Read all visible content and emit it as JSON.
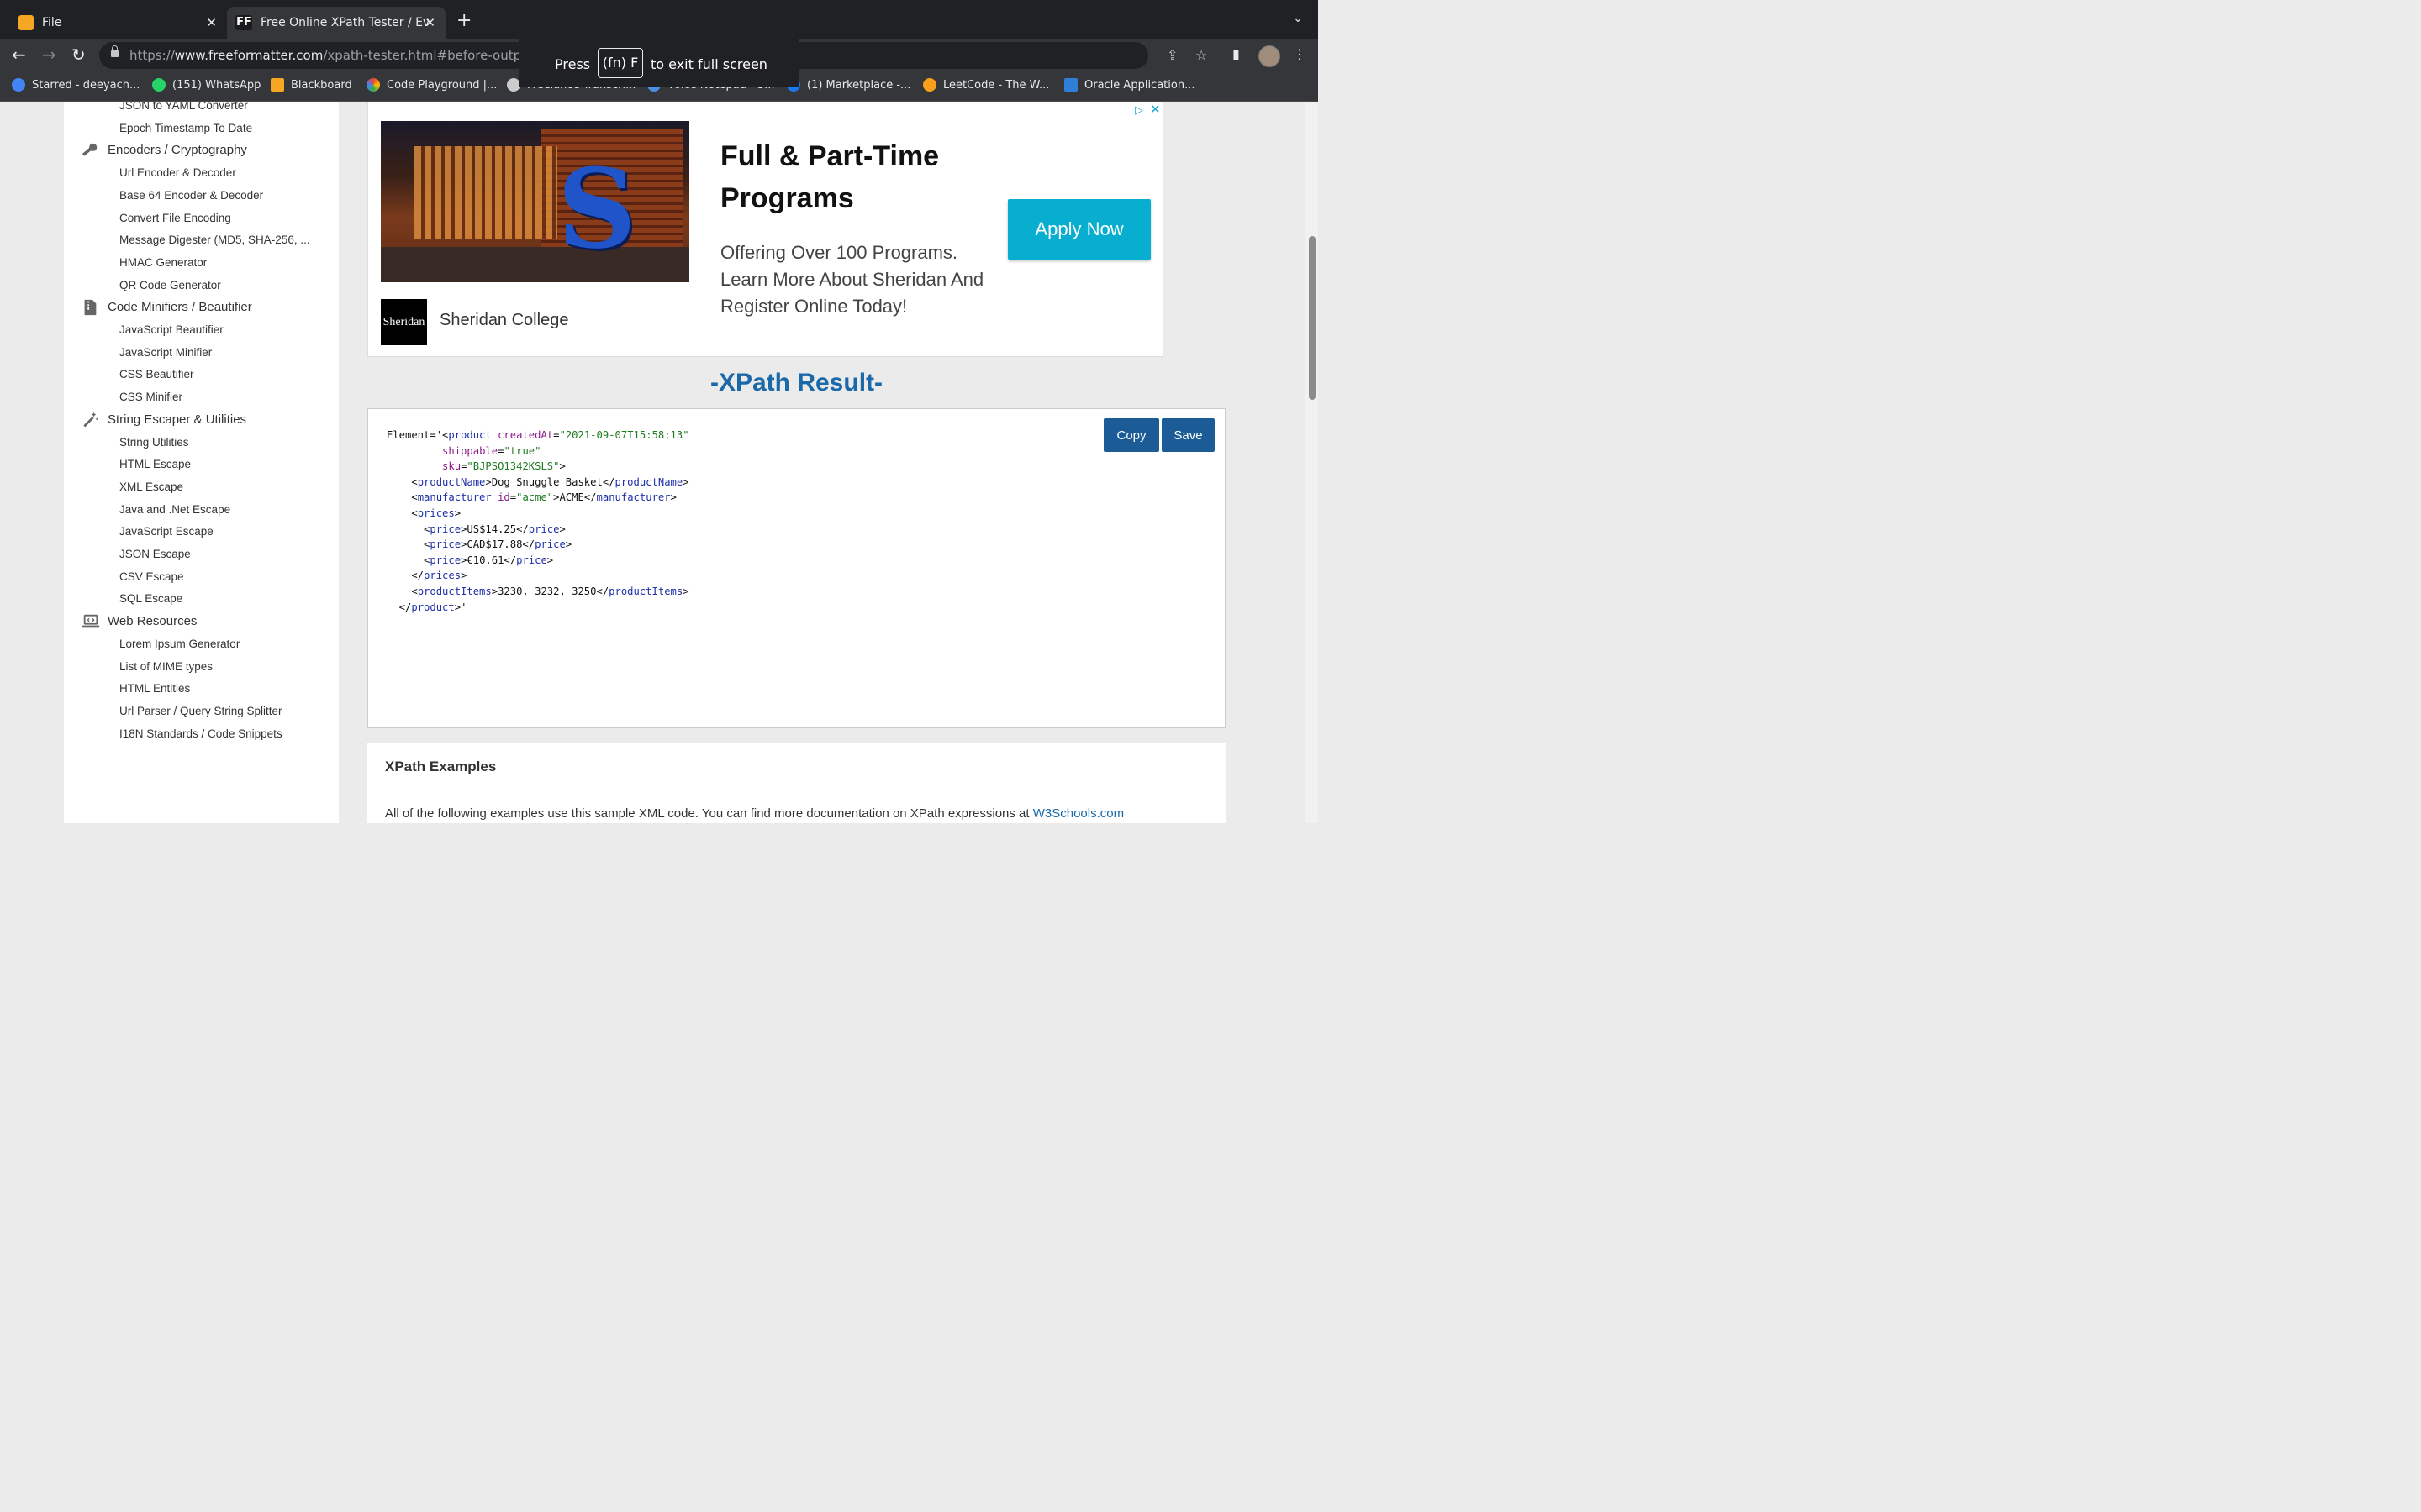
{
  "browser": {
    "tabs": [
      {
        "label": "File",
        "favicon": "pencil-file-icon"
      },
      {
        "label": "Free Online XPath Tester / Evalu",
        "favicon_text": "FF",
        "active": true
      }
    ],
    "url": {
      "scheme": "https://",
      "host": "www.freeformatter.com",
      "path": "/xpath-tester.html#before-output"
    },
    "bookmarks": [
      {
        "label": "Starred - deeyach...",
        "color": "#4285f4"
      },
      {
        "label": "(151) WhatsApp",
        "color": "#25d366"
      },
      {
        "label": "Blackboard",
        "color": "#f5a623"
      },
      {
        "label": "Code Playground |...",
        "color": "#e94235"
      },
      {
        "label": "Freelance Transcri...",
        "color": "#cccccc"
      },
      {
        "label": "Voice Notepad - S...",
        "color": "#4a90e2"
      },
      {
        "label": "(1) Marketplace -...",
        "color": "#1877f2"
      },
      {
        "label": "LeetCode - The W...",
        "color": "#f89f1b"
      },
      {
        "label": "Oracle Application...",
        "color": "#2f7ed8"
      }
    ],
    "fullscreen_hint": {
      "press": "Press",
      "key": "(fn) F",
      "rest": "to exit full screen"
    }
  },
  "sidebar": {
    "items": [
      {
        "type": "item",
        "label": "JSON to YAML Converter"
      },
      {
        "type": "item",
        "label": "Epoch Timestamp To Date"
      },
      {
        "type": "category",
        "label": "Encoders / Cryptography",
        "icon": "key-icon"
      },
      {
        "type": "item",
        "label": "Url Encoder & Decoder"
      },
      {
        "type": "item",
        "label": "Base 64 Encoder & Decoder"
      },
      {
        "type": "item",
        "label": "Convert File Encoding"
      },
      {
        "type": "item",
        "label": "Message Digester (MD5, SHA-256, ..."
      },
      {
        "type": "item",
        "label": "HMAC Generator"
      },
      {
        "type": "item",
        "label": "QR Code Generator"
      },
      {
        "type": "category",
        "label": "Code Minifiers / Beautifier",
        "icon": "zip-file-icon"
      },
      {
        "type": "item",
        "label": "JavaScript Beautifier"
      },
      {
        "type": "item",
        "label": "JavaScript Minifier"
      },
      {
        "type": "item",
        "label": "CSS Beautifier"
      },
      {
        "type": "item",
        "label": "CSS Minifier"
      },
      {
        "type": "category",
        "label": "String Escaper & Utilities",
        "icon": "magic-wand-icon"
      },
      {
        "type": "item",
        "label": "String Utilities"
      },
      {
        "type": "item",
        "label": "HTML Escape"
      },
      {
        "type": "item",
        "label": "XML Escape"
      },
      {
        "type": "item",
        "label": "Java and .Net Escape"
      },
      {
        "type": "item",
        "label": "JavaScript Escape"
      },
      {
        "type": "item",
        "label": "JSON Escape"
      },
      {
        "type": "item",
        "label": "CSV Escape"
      },
      {
        "type": "item",
        "label": "SQL Escape"
      },
      {
        "type": "category",
        "label": "Web Resources",
        "icon": "laptop-code-icon"
      },
      {
        "type": "item",
        "label": "Lorem Ipsum Generator"
      },
      {
        "type": "item",
        "label": "List of MIME types"
      },
      {
        "type": "item",
        "label": "HTML Entities"
      },
      {
        "type": "item",
        "label": "Url Parser / Query String Splitter"
      },
      {
        "type": "item",
        "label": "I18N Standards / Code Snippets"
      }
    ]
  },
  "ad": {
    "headline": "Full & Part-Time Programs",
    "body": "Offering Over 100 Programs. Learn More About Sheridan And Register Online Today!",
    "cta": "Apply Now",
    "logo_text": "Sheridan",
    "brand": "Sheridan College"
  },
  "result": {
    "title": "-XPath Result-",
    "copy_label": "Copy",
    "save_label": "Save",
    "code_lines": [
      [
        [
          "t",
          "Element='<"
        ],
        [
          "g",
          "product"
        ],
        [
          "t",
          " "
        ],
        [
          "a",
          "createdAt"
        ],
        [
          "t",
          "="
        ],
        [
          "s",
          "\"2021-09-07T15:58:13\""
        ]
      ],
      [
        [
          "t",
          "         "
        ],
        [
          "a",
          "shippable"
        ],
        [
          "t",
          "="
        ],
        [
          "s",
          "\"true\""
        ]
      ],
      [
        [
          "t",
          "         "
        ],
        [
          "a",
          "sku"
        ],
        [
          "t",
          "="
        ],
        [
          "s",
          "\"BJPSO1342KSLS\""
        ],
        [
          "t",
          ">"
        ]
      ],
      [
        [
          "t",
          "    <"
        ],
        [
          "g",
          "productName"
        ],
        [
          "t",
          ">Dog Snuggle Basket</"
        ],
        [
          "g",
          "productName"
        ],
        [
          "t",
          ">"
        ]
      ],
      [
        [
          "t",
          "    <"
        ],
        [
          "g",
          "manufacturer"
        ],
        [
          "t",
          " "
        ],
        [
          "a",
          "id"
        ],
        [
          "t",
          "="
        ],
        [
          "s",
          "\"acme\""
        ],
        [
          "t",
          ">ACME</"
        ],
        [
          "g",
          "manufacturer"
        ],
        [
          "t",
          ">"
        ]
      ],
      [
        [
          "t",
          "    <"
        ],
        [
          "g",
          "prices"
        ],
        [
          "t",
          ">"
        ]
      ],
      [
        [
          "t",
          "      <"
        ],
        [
          "g",
          "price"
        ],
        [
          "t",
          ">US$14.25</"
        ],
        [
          "g",
          "price"
        ],
        [
          "t",
          ">"
        ]
      ],
      [
        [
          "t",
          "      <"
        ],
        [
          "g",
          "price"
        ],
        [
          "t",
          ">CAD$17.88</"
        ],
        [
          "g",
          "price"
        ],
        [
          "t",
          ">"
        ]
      ],
      [
        [
          "t",
          "      <"
        ],
        [
          "g",
          "price"
        ],
        [
          "t",
          ">€10.61</"
        ],
        [
          "g",
          "price"
        ],
        [
          "t",
          ">"
        ]
      ],
      [
        [
          "t",
          "    </"
        ],
        [
          "g",
          "prices"
        ],
        [
          "t",
          ">"
        ]
      ],
      [
        [
          "t",
          "    <"
        ],
        [
          "g",
          "productItems"
        ],
        [
          "t",
          ">3230, 3232, 3250</"
        ],
        [
          "g",
          "productItems"
        ],
        [
          "t",
          ">"
        ]
      ],
      [
        [
          "t",
          "  </"
        ],
        [
          "g",
          "product"
        ],
        [
          "t",
          ">'"
        ]
      ]
    ]
  },
  "examples": {
    "title": "XPath Examples",
    "text": "All of the following examples use this sample XML code. You can find more documentation on XPath expressions at ",
    "link": "W3Schools.com"
  },
  "colors": {
    "accent": "#1b69a8",
    "button": "#1b5c96",
    "ad_cta": "#08aecf"
  }
}
